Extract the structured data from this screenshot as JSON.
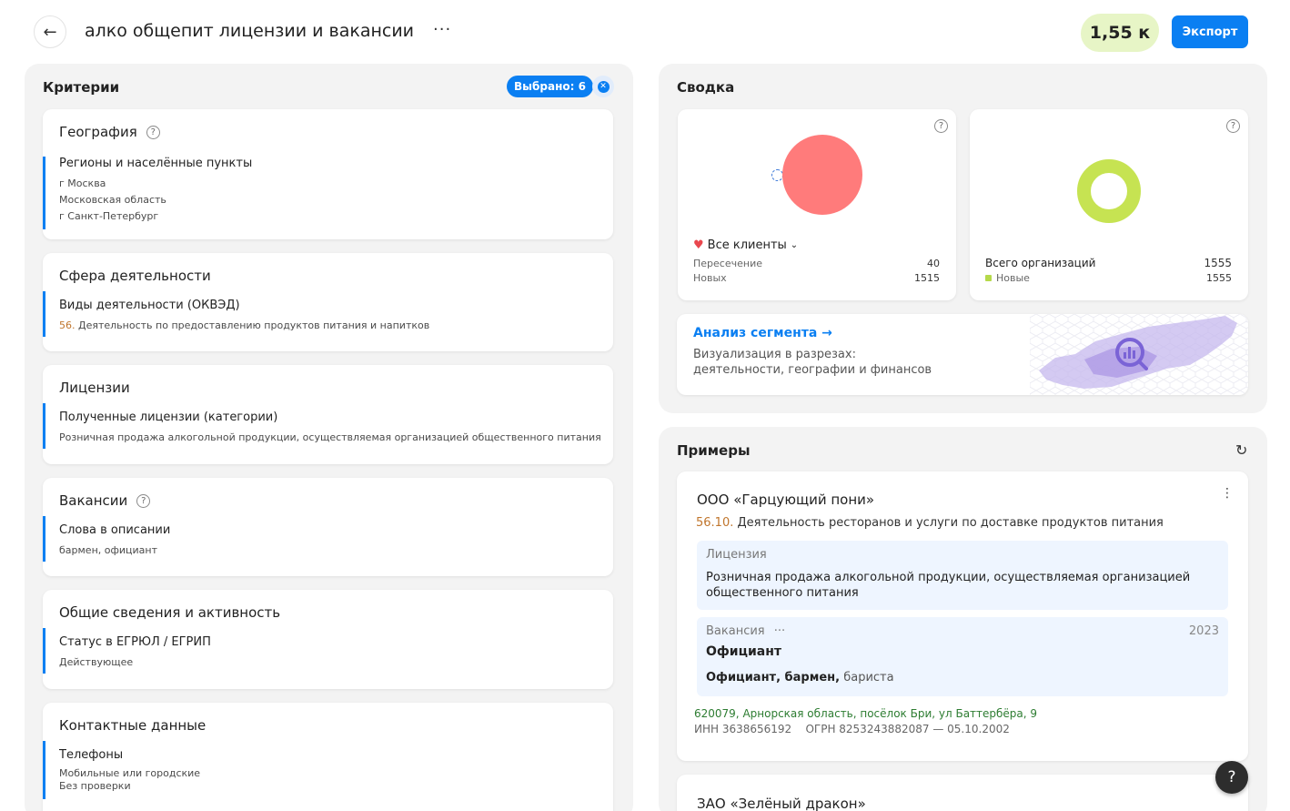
{
  "header": {
    "title": "алко общепит лицензии и вакансии",
    "more_label": "···",
    "count": "1,55 к",
    "export_label": "Экспорт"
  },
  "criteria": {
    "title": "Критерии",
    "selected_label": "Выбрано: 6",
    "cards": [
      {
        "title": "География",
        "has_help": true,
        "subtitle": "Регионы и населённые пункты",
        "lines": [
          "г Москва",
          "Московская область",
          "г Санкт-Петербург"
        ]
      },
      {
        "title": "Сфера деятельности",
        "subtitle": "Виды деятельности (ОКВЭД)",
        "code": "56.",
        "line": "Деятельность по предоставлению продуктов питания и напитков"
      },
      {
        "title": "Лицензии",
        "subtitle": "Полученные лицензии (категории)",
        "line": "Розничная продажа алкогольной продукции, осуществляемая организацией общественного питания"
      },
      {
        "title": "Вакансии",
        "has_help": true,
        "subtitle": "Слова в описании",
        "line": "бармен, официант"
      },
      {
        "title": "Общие сведения и активность",
        "subtitle": "Статус в ЕГРЮЛ / ЕГРИП",
        "line": "Действующее"
      },
      {
        "title": "Контактные данные",
        "subtitle": "Телефоны",
        "lines": [
          "Мобильные или городские",
          "Без проверки"
        ]
      }
    ]
  },
  "summary": {
    "title": "Сводка",
    "clients": {
      "label": "Все клиенты",
      "rows": [
        {
          "label": "Пересечение",
          "value": "40"
        },
        {
          "label": "Новых",
          "value": "1515"
        }
      ]
    },
    "orgs": {
      "rows": [
        {
          "label": "Всего организаций",
          "value": "1555"
        },
        {
          "label": "Новые",
          "value": "1555"
        }
      ]
    },
    "analysis": {
      "link": "Анализ сегмента →",
      "desc1": "Визуализация в разрезах:",
      "desc2": "деятельности, географии и финансов"
    }
  },
  "examples": {
    "title": "Примеры",
    "items": [
      {
        "name": "ООО «Гарцующий пони»",
        "okved_code": "56.10.",
        "okved_text": " Деятельность ресторанов и услуги по доставке продуктов питания",
        "license_label": "Лицензия",
        "license_text_1": "Розничная продажа алкогольной продукции, осуществляемая организацией",
        "license_text_2": "общественного питания",
        "vacancy_label": "Вакансия",
        "vacancy_more": "···",
        "vacancy_year": "2023",
        "vacancy_title": "Официант",
        "vacancy_words_bold": "Официант, бармен,",
        "vacancy_words_rest": " бариста",
        "address": "620079, Арнорская область, посёлок Бри, ул Баттербёра, 9",
        "ids": "ИНН 3638656192    ОГРН 8253243882087 — 05.10.2002"
      },
      {
        "name": "ЗАО «Зелёный дракон»"
      }
    ]
  },
  "help_label": "?",
  "colors": {
    "accent": "#0a7ff2",
    "clients_circle": "#ff7b7b",
    "orgs_ring": "#c6e352",
    "count_blob": "#e7f5c6"
  }
}
